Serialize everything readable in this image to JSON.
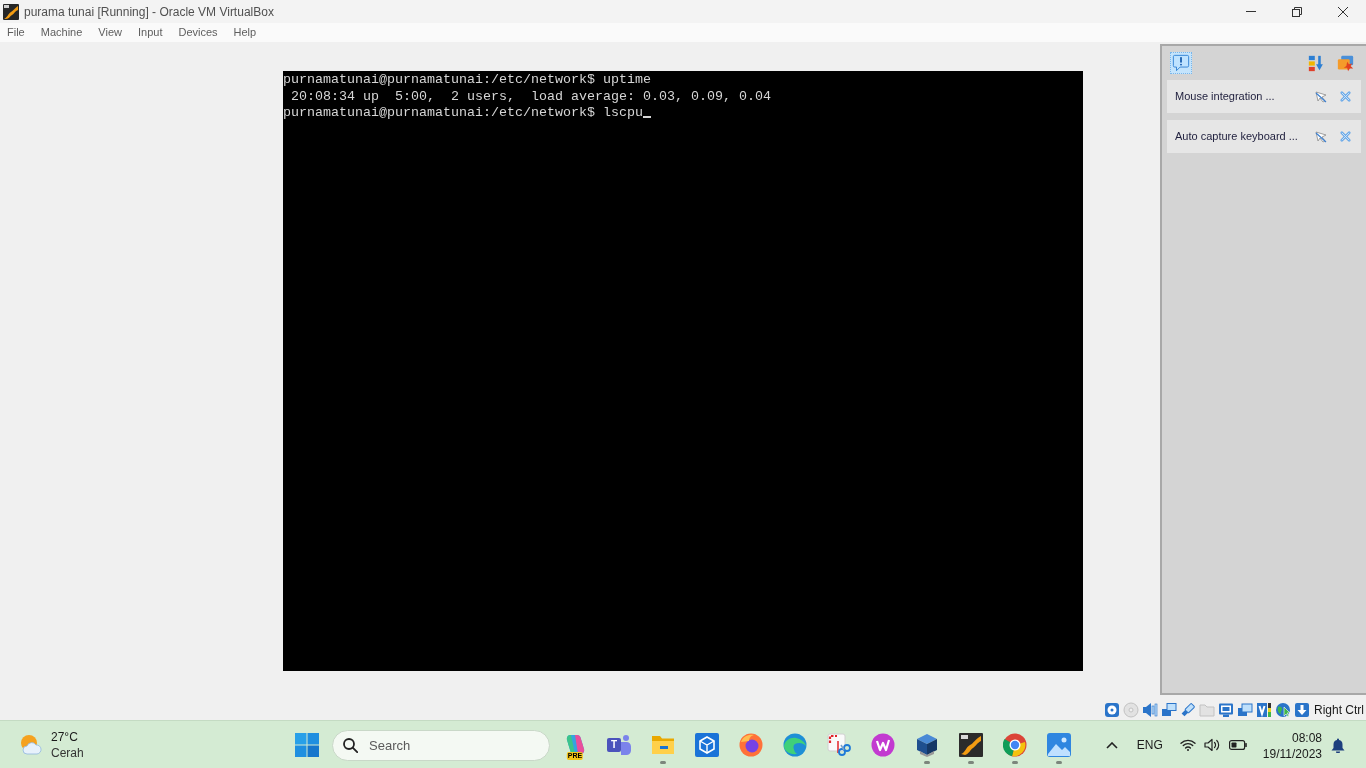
{
  "window": {
    "title": "purama tunai [Running] - Oracle VM VirtualBox"
  },
  "menu": [
    {
      "label": "File"
    },
    {
      "label": "Machine"
    },
    {
      "label": "View"
    },
    {
      "label": "Input"
    },
    {
      "label": "Devices"
    },
    {
      "label": "Help"
    }
  ],
  "terminal": {
    "lines": [
      "purnamatunai@purnamatunai:/etc/network$ uptime",
      " 20:08:34 up  5:00,  2 users,  load average: 0.03, 0.09, 0.04",
      "purnamatunai@purnamatunai:/etc/network$ lscpu"
    ],
    "cursor": true
  },
  "notification_panel": {
    "toolbar": [
      {
        "kind": "alert",
        "selected": true
      },
      {
        "kind": "sort",
        "selected": false
      },
      {
        "kind": "clear",
        "selected": false
      }
    ],
    "items": [
      {
        "text": "Mouse integration ..."
      },
      {
        "text": "Auto capture keyboard ..."
      }
    ]
  },
  "status_bar": {
    "indicators": [
      {
        "kind": "hard-disk",
        "disabled": false
      },
      {
        "kind": "optical",
        "disabled": true
      },
      {
        "kind": "audio",
        "disabled": false
      },
      {
        "kind": "network",
        "disabled": false
      },
      {
        "kind": "usb",
        "disabled": false
      },
      {
        "kind": "shared-folders",
        "disabled": true
      },
      {
        "kind": "display",
        "disabled": false
      },
      {
        "kind": "capture",
        "disabled": false
      },
      {
        "kind": "cpu",
        "disabled": false
      },
      {
        "kind": "mouse",
        "disabled": false
      },
      {
        "kind": "keyboard",
        "disabled": false
      }
    ],
    "host_key": "Right Ctrl"
  },
  "taskbar": {
    "weather": {
      "temperature": "27°C",
      "condition": "Cerah"
    },
    "search": {
      "placeholder": "Search"
    },
    "apps": [
      {
        "kind": "copilot",
        "badge": "PRE",
        "running": false
      },
      {
        "kind": "teams",
        "letter": "T",
        "running": false
      },
      {
        "kind": "folder",
        "running": true
      },
      {
        "kind": "hexagon",
        "running": false
      },
      {
        "kind": "firefox",
        "running": false
      },
      {
        "kind": "edge",
        "running": false
      },
      {
        "kind": "snipping",
        "running": false
      },
      {
        "kind": "wps",
        "running": false
      },
      {
        "kind": "virtualbox",
        "running": true
      },
      {
        "kind": "orange-tile",
        "running": true
      },
      {
        "kind": "chrome",
        "running": true
      },
      {
        "kind": "photos",
        "running": true
      }
    ],
    "tray": {
      "language": "ENG"
    },
    "clock": {
      "time": "08:08",
      "date": "19/11/2023"
    }
  }
}
